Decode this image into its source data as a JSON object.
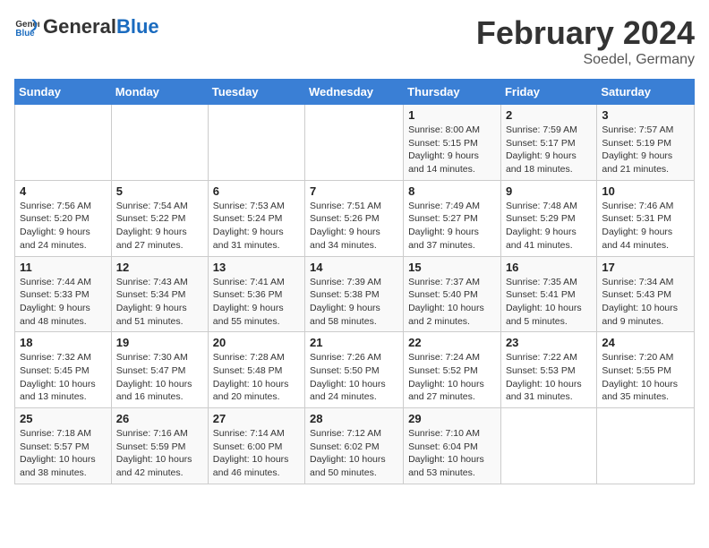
{
  "header": {
    "logo_general": "General",
    "logo_blue": "Blue",
    "month_title": "February 2024",
    "location": "Soedel, Germany"
  },
  "calendar": {
    "weekdays": [
      "Sunday",
      "Monday",
      "Tuesday",
      "Wednesday",
      "Thursday",
      "Friday",
      "Saturday"
    ],
    "weeks": [
      [
        {
          "day": "",
          "info": ""
        },
        {
          "day": "",
          "info": ""
        },
        {
          "day": "",
          "info": ""
        },
        {
          "day": "",
          "info": ""
        },
        {
          "day": "1",
          "info": "Sunrise: 8:00 AM\nSunset: 5:15 PM\nDaylight: 9 hours\nand 14 minutes."
        },
        {
          "day": "2",
          "info": "Sunrise: 7:59 AM\nSunset: 5:17 PM\nDaylight: 9 hours\nand 18 minutes."
        },
        {
          "day": "3",
          "info": "Sunrise: 7:57 AM\nSunset: 5:19 PM\nDaylight: 9 hours\nand 21 minutes."
        }
      ],
      [
        {
          "day": "4",
          "info": "Sunrise: 7:56 AM\nSunset: 5:20 PM\nDaylight: 9 hours\nand 24 minutes."
        },
        {
          "day": "5",
          "info": "Sunrise: 7:54 AM\nSunset: 5:22 PM\nDaylight: 9 hours\nand 27 minutes."
        },
        {
          "day": "6",
          "info": "Sunrise: 7:53 AM\nSunset: 5:24 PM\nDaylight: 9 hours\nand 31 minutes."
        },
        {
          "day": "7",
          "info": "Sunrise: 7:51 AM\nSunset: 5:26 PM\nDaylight: 9 hours\nand 34 minutes."
        },
        {
          "day": "8",
          "info": "Sunrise: 7:49 AM\nSunset: 5:27 PM\nDaylight: 9 hours\nand 37 minutes."
        },
        {
          "day": "9",
          "info": "Sunrise: 7:48 AM\nSunset: 5:29 PM\nDaylight: 9 hours\nand 41 minutes."
        },
        {
          "day": "10",
          "info": "Sunrise: 7:46 AM\nSunset: 5:31 PM\nDaylight: 9 hours\nand 44 minutes."
        }
      ],
      [
        {
          "day": "11",
          "info": "Sunrise: 7:44 AM\nSunset: 5:33 PM\nDaylight: 9 hours\nand 48 minutes."
        },
        {
          "day": "12",
          "info": "Sunrise: 7:43 AM\nSunset: 5:34 PM\nDaylight: 9 hours\nand 51 minutes."
        },
        {
          "day": "13",
          "info": "Sunrise: 7:41 AM\nSunset: 5:36 PM\nDaylight: 9 hours\nand 55 minutes."
        },
        {
          "day": "14",
          "info": "Sunrise: 7:39 AM\nSunset: 5:38 PM\nDaylight: 9 hours\nand 58 minutes."
        },
        {
          "day": "15",
          "info": "Sunrise: 7:37 AM\nSunset: 5:40 PM\nDaylight: 10 hours\nand 2 minutes."
        },
        {
          "day": "16",
          "info": "Sunrise: 7:35 AM\nSunset: 5:41 PM\nDaylight: 10 hours\nand 5 minutes."
        },
        {
          "day": "17",
          "info": "Sunrise: 7:34 AM\nSunset: 5:43 PM\nDaylight: 10 hours\nand 9 minutes."
        }
      ],
      [
        {
          "day": "18",
          "info": "Sunrise: 7:32 AM\nSunset: 5:45 PM\nDaylight: 10 hours\nand 13 minutes."
        },
        {
          "day": "19",
          "info": "Sunrise: 7:30 AM\nSunset: 5:47 PM\nDaylight: 10 hours\nand 16 minutes."
        },
        {
          "day": "20",
          "info": "Sunrise: 7:28 AM\nSunset: 5:48 PM\nDaylight: 10 hours\nand 20 minutes."
        },
        {
          "day": "21",
          "info": "Sunrise: 7:26 AM\nSunset: 5:50 PM\nDaylight: 10 hours\nand 24 minutes."
        },
        {
          "day": "22",
          "info": "Sunrise: 7:24 AM\nSunset: 5:52 PM\nDaylight: 10 hours\nand 27 minutes."
        },
        {
          "day": "23",
          "info": "Sunrise: 7:22 AM\nSunset: 5:53 PM\nDaylight: 10 hours\nand 31 minutes."
        },
        {
          "day": "24",
          "info": "Sunrise: 7:20 AM\nSunset: 5:55 PM\nDaylight: 10 hours\nand 35 minutes."
        }
      ],
      [
        {
          "day": "25",
          "info": "Sunrise: 7:18 AM\nSunset: 5:57 PM\nDaylight: 10 hours\nand 38 minutes."
        },
        {
          "day": "26",
          "info": "Sunrise: 7:16 AM\nSunset: 5:59 PM\nDaylight: 10 hours\nand 42 minutes."
        },
        {
          "day": "27",
          "info": "Sunrise: 7:14 AM\nSunset: 6:00 PM\nDaylight: 10 hours\nand 46 minutes."
        },
        {
          "day": "28",
          "info": "Sunrise: 7:12 AM\nSunset: 6:02 PM\nDaylight: 10 hours\nand 50 minutes."
        },
        {
          "day": "29",
          "info": "Sunrise: 7:10 AM\nSunset: 6:04 PM\nDaylight: 10 hours\nand 53 minutes."
        },
        {
          "day": "",
          "info": ""
        },
        {
          "day": "",
          "info": ""
        }
      ]
    ]
  }
}
